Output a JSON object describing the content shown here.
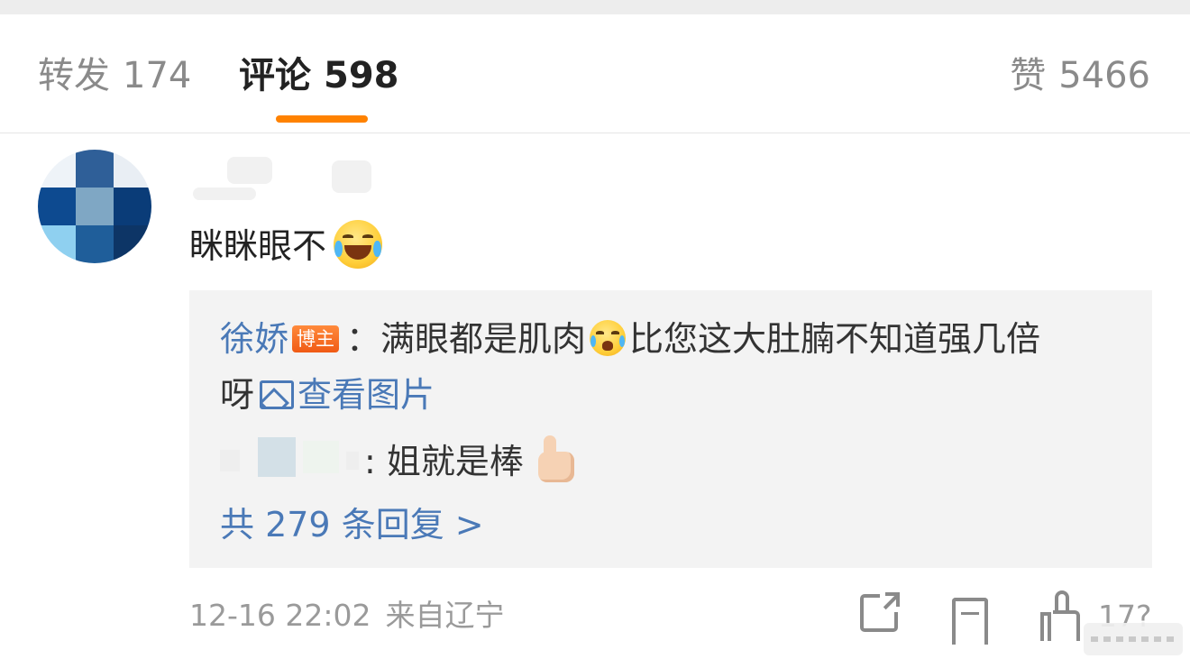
{
  "tabs": {
    "repost_label": "转发",
    "repost_count": "174",
    "comments_label": "评论",
    "comments_count": "598",
    "likes_label": "赞",
    "likes_count": "5466",
    "active_tab": "comments",
    "accent_color": "#ff8200"
  },
  "comment": {
    "text": "眯眯眼不",
    "emoji": "laugh-cry-emoji",
    "reply_box": {
      "author_reply": {
        "author": "徐娇",
        "badge": "博主",
        "text_part1": "：满眼都是肌肉",
        "emoji": "crying-emoji",
        "text_part2": "比您这大肚腩不知道强几倍",
        "text_part3": "呀",
        "view_image_label": "查看图片"
      },
      "second_reply": {
        "text": ": 姐就是棒",
        "emoji": "thumbs-up-emoji"
      },
      "more_replies_label": "共 279 条回复 >"
    },
    "meta": {
      "date": "12-16 22:02",
      "location": "来自辽宁"
    },
    "actions": {
      "like_count": "17?"
    },
    "link_color": "#4a79b7"
  }
}
